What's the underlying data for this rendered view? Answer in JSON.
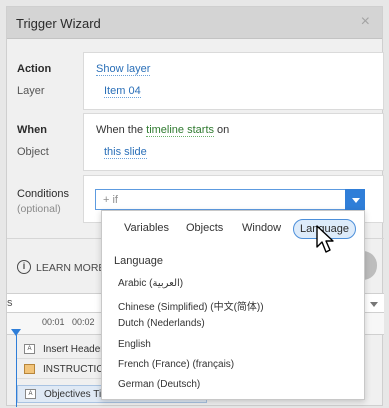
{
  "dialog": {
    "title": "Trigger Wizard",
    "close_symbol": "×"
  },
  "action": {
    "label": "Action",
    "value": "Show layer",
    "layer_label": "Layer",
    "layer_value": "Item 04"
  },
  "when": {
    "label": "When",
    "prefix": "When the ",
    "event": "timeline starts",
    "suffix": " on",
    "object_label": "Object",
    "object_value": "this slide"
  },
  "conditions": {
    "label": "Conditions",
    "optional": "(optional)",
    "input_value": "+ if"
  },
  "popup": {
    "tabs": [
      {
        "label": "Variables",
        "active": false
      },
      {
        "label": "Objects",
        "active": false
      },
      {
        "label": "Window",
        "active": false
      },
      {
        "label": "Language",
        "active": true
      }
    ],
    "header": "Language",
    "items": [
      "Arabic (العربية)",
      "Chinese (Simplified) (中文(简体))",
      "Dutch (Nederlands)",
      "English",
      "French (France) (français)",
      "German (Deutsch)"
    ]
  },
  "learn_more": {
    "label": "LEARN MORE",
    "icon": "i"
  },
  "timeline": {
    "scroll_label": "s",
    "ticks": [
      "00:01",
      "00:02"
    ],
    "layers": [
      {
        "name": "Insert Header",
        "icon": "text"
      },
      {
        "name": "INSTRUCTIO",
        "icon": "image"
      },
      {
        "name": "Objectives Title",
        "icon": "text"
      }
    ]
  },
  "icons": {
    "info": "info-icon",
    "close": "close-icon",
    "dropdown": "chevron-down-icon",
    "cursor": "mouse-pointer-icon"
  },
  "colors": {
    "accent": "#2f7ed8",
    "link": "#2a6fb8",
    "event_link": "#2f7a2f",
    "active_tab_bg": "#ddebfa"
  }
}
